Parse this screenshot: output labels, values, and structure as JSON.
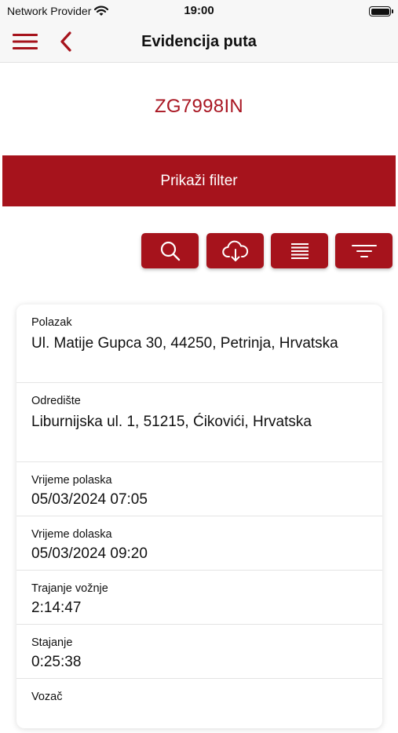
{
  "status_bar": {
    "carrier": "Network Provider",
    "time": "19:00",
    "icons": [
      "wifi-icon",
      "battery-icon"
    ]
  },
  "nav": {
    "title": "Evidencija puta",
    "icons": [
      "hamburger-menu-icon",
      "chevron-left-icon"
    ]
  },
  "vehicle": {
    "plate": "ZG7998IN"
  },
  "filter_button": {
    "label": "Prikaži filter"
  },
  "toolbar": {
    "buttons": [
      {
        "icon": "search-icon"
      },
      {
        "icon": "cloud-download-icon"
      },
      {
        "icon": "list-icon"
      },
      {
        "icon": "filter-icon"
      }
    ]
  },
  "trip": {
    "departure": {
      "label": "Polazak",
      "value": "Ul. Matije Gupca 30, 44250, Petrinja, Hrvatska"
    },
    "destination": {
      "label": "Odredište",
      "value": "Liburnijska ul. 1, 51215, Ćikovići, Hrvatska"
    },
    "departure_time": {
      "label": "Vrijeme polaska",
      "value": "05/03/2024 07:05"
    },
    "arrival_time": {
      "label": "Vrijeme dolaska",
      "value": "05/03/2024 09:20"
    },
    "duration": {
      "label": "Trajanje vožnje",
      "value": "2:14:47"
    },
    "stop_time": {
      "label": "Stajanje",
      "value": "0:25:38"
    },
    "driver": {
      "label": "Vozač",
      "value": ""
    }
  },
  "colors": {
    "accent": "#a6131c",
    "plate_text": "#a91622",
    "nav_background": "#f7f7f7"
  }
}
